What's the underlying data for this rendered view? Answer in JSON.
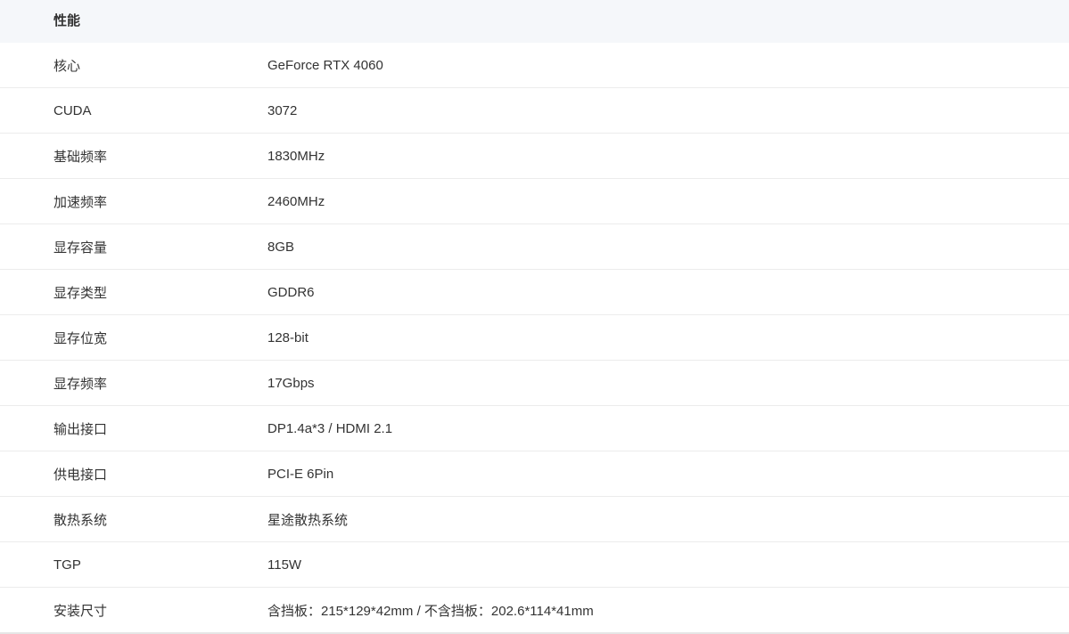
{
  "section": {
    "title": "性能"
  },
  "specs": [
    {
      "label": "核心",
      "value": "GeForce RTX 4060"
    },
    {
      "label": "CUDA",
      "value": "3072"
    },
    {
      "label": "基础频率",
      "value": "1830MHz"
    },
    {
      "label": "加速频率",
      "value": "2460MHz"
    },
    {
      "label": "显存容量",
      "value": "8GB"
    },
    {
      "label": "显存类型",
      "value": "GDDR6"
    },
    {
      "label": "显存位宽",
      "value": "128-bit"
    },
    {
      "label": "显存频率",
      "value": "17Gbps"
    },
    {
      "label": "输出接口",
      "value": "DP1.4a*3 / HDMI 2.1"
    },
    {
      "label": "供电接口",
      "value": "PCI-E 6Pin"
    },
    {
      "label": "散热系统",
      "value": "星途散热系统"
    },
    {
      "label": "TGP",
      "value": "115W"
    },
    {
      "label": "安装尺寸",
      "value": "含挡板：215*129*42mm / 不含挡板：202.6*114*41mm"
    }
  ]
}
